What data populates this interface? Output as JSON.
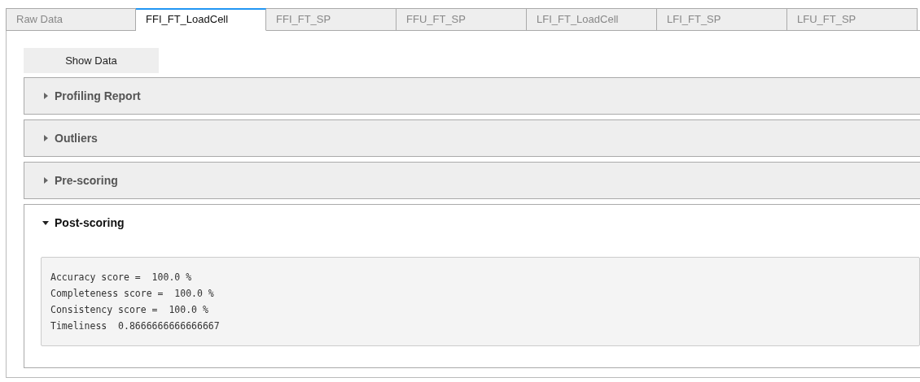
{
  "tabs": [
    {
      "label": "Raw Data",
      "selected": false
    },
    {
      "label": "FFI_FT_LoadCell",
      "selected": true
    },
    {
      "label": "FFI_FT_SP",
      "selected": false
    },
    {
      "label": "FFU_FT_SP",
      "selected": false
    },
    {
      "label": "LFI_FT_LoadCell",
      "selected": false
    },
    {
      "label": "LFI_FT_SP",
      "selected": false
    },
    {
      "label": "LFU_FT_SP",
      "selected": false
    }
  ],
  "show_data_button": "Show Data",
  "sections": [
    {
      "title": "Profiling Report",
      "expanded": false
    },
    {
      "title": "Outliers",
      "expanded": false
    },
    {
      "title": "Pre-scoring",
      "expanded": false
    },
    {
      "title": "Post-scoring",
      "expanded": true,
      "output_lines": [
        "Accuracy score =  100.0 %",
        "Completeness score =  100.0 %",
        "Consistency score =  100.0 %",
        "Timeliness  0.8666666666666667"
      ]
    }
  ]
}
